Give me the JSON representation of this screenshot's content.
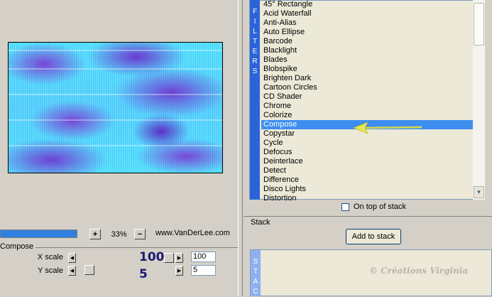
{
  "preview": {
    "zoom_minus": "−",
    "zoom_plus": "+",
    "zoom_level": "33%",
    "website": "www.VanDerLee.com"
  },
  "compose": {
    "group_label": "Compose",
    "x_scale": {
      "label": "X scale",
      "big_value": "100",
      "field_value": "100"
    },
    "y_scale": {
      "label": "Y scale",
      "big_value": "5",
      "field_value": "5"
    }
  },
  "filters": {
    "side_label": "FILTERS",
    "items": [
      "45° Rectangle",
      "Acid Waterfall",
      "Anti-Alias",
      "Auto Ellipse",
      "Barcode",
      "Blacklight",
      "Blades",
      "Blobspike",
      "Brighten Dark",
      "Cartoon Circles",
      "CD Shader",
      "Chrome",
      "Colorize",
      "Compose",
      "Copystar",
      "Cycle",
      "Defocus",
      "Deinterlace",
      "Detect",
      "Difference",
      "Disco Lights",
      "Distortion"
    ],
    "selected_index": 13
  },
  "stack": {
    "on_top_label": "On top of stack",
    "group_label": "Stack",
    "add_button": "Add to stack",
    "side_label": "STAC"
  },
  "watermark": "© Créations Virginia",
  "colors": {
    "selection": "#3d8ef0",
    "sidebar": "#2c64d8",
    "arrow": "#e6e650"
  },
  "icons": {
    "scroll_down": "chevron-down-icon",
    "arrow_left": "triangle-left-icon",
    "arrow_right": "triangle-right-icon"
  }
}
